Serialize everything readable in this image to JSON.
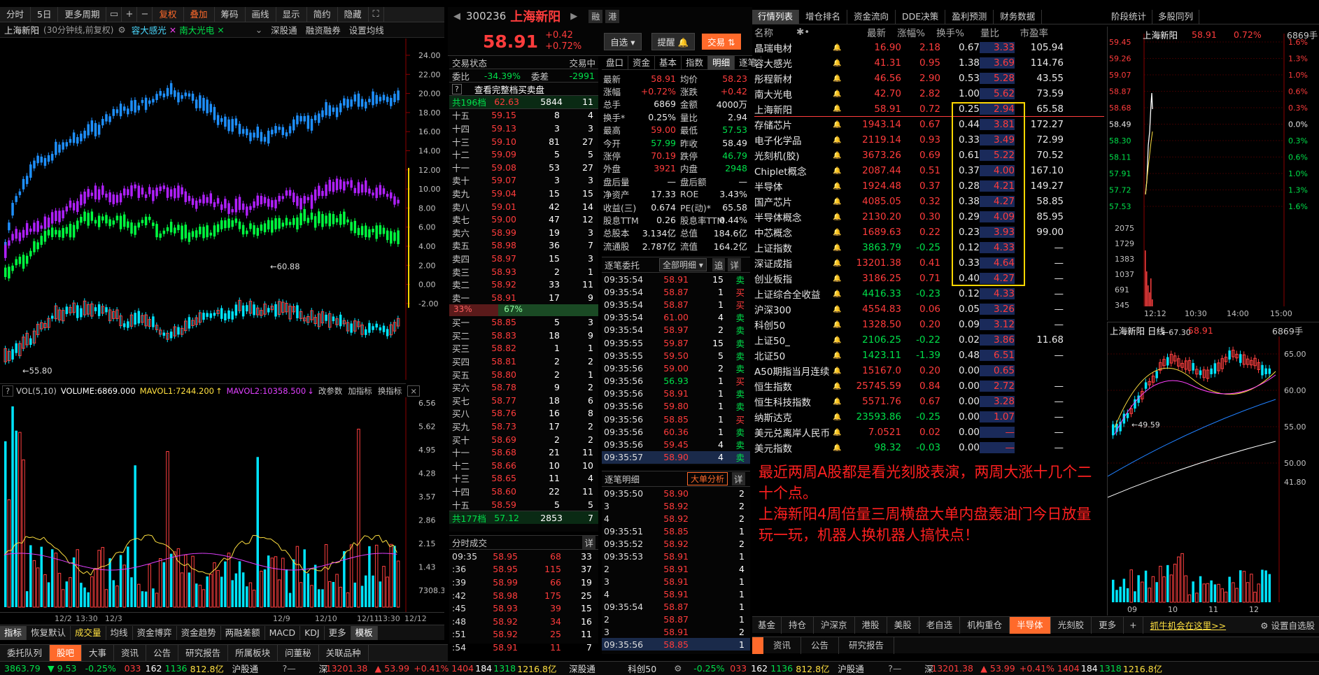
{
  "topbar": {
    "items": [
      "分时",
      "5日",
      "更多周期",
      "复权",
      "叠加",
      "筹码",
      "画线",
      "显示",
      "简约",
      "隐藏"
    ],
    "highlight": [
      "复权",
      "叠加"
    ]
  },
  "chart_header": {
    "stock": "上海新阳",
    "period_note": "(30分钟线,前复权)",
    "overlay1": "容大感光",
    "overlay2": "南大光电",
    "links": [
      "深股通",
      "融资融券",
      "设置均线"
    ]
  },
  "main_chart": {
    "y_right": [
      "24.00",
      "22.00",
      "20.00",
      "18.00",
      "16.00",
      "14.00",
      "12.00",
      "10.00",
      "8.00",
      "6.00",
      "4.00",
      "2.00",
      "0.00",
      "-2.00"
    ],
    "high_label": "60.88",
    "low_label": "55.80"
  },
  "vol_header": {
    "vol": "VOL(5,10)",
    "volume": "VOLUME:6869.000",
    "mavol1": "MAVOL1:7244.200",
    "mavol2": "MAVOL2:10358.500",
    "links": [
      "改参数",
      "加指标",
      "换指标"
    ]
  },
  "vol_axis": [
    "6.56",
    "5.62",
    "4.95",
    "4.28",
    "3.57",
    "2.86",
    "2.15",
    "1.43",
    "7308.33"
  ],
  "x_dates": [
    "12/2",
    "13:30",
    "12/3",
    "12/9",
    "12/10",
    "12/11",
    "13:30",
    "12/12"
  ],
  "chart_tabs": [
    "指标",
    "恢复默认",
    "成交量",
    "均线",
    "资金博弈",
    "资金趋势",
    "两融差额",
    "MACD",
    "KDJ",
    "更多",
    "模板"
  ],
  "bottom_tabs_left": [
    "委托队列",
    "股吧",
    "大事",
    "资讯",
    "公告",
    "研究报告",
    "所属板块",
    "问董秘",
    "关联品种"
  ],
  "quote": {
    "code": "300236",
    "name": "上海新阳",
    "price": "58.91",
    "change": "+0.42",
    "change_pct": "+0.72%",
    "btn_self": "自选",
    "btn_alert": "提醒",
    "btn_trade": "交易",
    "tags": [
      "融",
      "港"
    ]
  },
  "order_book": {
    "status_label": "交易状态",
    "status": "交易中",
    "weibi_label": "委比",
    "weibi": "-34.39%",
    "weicha_label": "委差",
    "weicha": "-2991",
    "view_full": "查看完整档买卖盘",
    "total_sell": {
      "label": "共196档",
      "price": "62.63",
      "vol": "5844",
      "n": "11"
    },
    "sells": [
      {
        "l": "十五",
        "p": "59.15",
        "v": "8",
        "n": "4"
      },
      {
        "l": "十四",
        "p": "59.13",
        "v": "3",
        "n": "3"
      },
      {
        "l": "十三",
        "p": "59.10",
        "v": "81",
        "n": "27"
      },
      {
        "l": "十二",
        "p": "59.09",
        "v": "5",
        "n": "5"
      },
      {
        "l": "十一",
        "p": "59.08",
        "v": "53",
        "n": "27"
      },
      {
        "l": "卖十",
        "p": "59.07",
        "v": "3",
        "n": "3"
      },
      {
        "l": "卖九",
        "p": "59.04",
        "v": "15",
        "n": "15"
      },
      {
        "l": "卖八",
        "p": "59.01",
        "v": "42",
        "n": "14"
      },
      {
        "l": "卖七",
        "p": "59.00",
        "v": "47",
        "n": "12"
      },
      {
        "l": "卖六",
        "p": "58.99",
        "v": "19",
        "n": "3"
      },
      {
        "l": "卖五",
        "p": "58.98",
        "v": "36",
        "n": "7"
      },
      {
        "l": "卖四",
        "p": "58.97",
        "v": "15",
        "n": "3"
      },
      {
        "l": "卖三",
        "p": "58.93",
        "v": "2",
        "n": "1"
      },
      {
        "l": "卖二",
        "p": "58.92",
        "v": "33",
        "n": "11"
      },
      {
        "l": "卖一",
        "p": "58.91",
        "v": "17",
        "n": "9"
      }
    ],
    "ratio_buy": "33%",
    "ratio_sell": "67%",
    "buys": [
      {
        "l": "买一",
        "p": "58.85",
        "v": "5",
        "n": "3"
      },
      {
        "l": "买二",
        "p": "58.83",
        "v": "18",
        "n": "9"
      },
      {
        "l": "买三",
        "p": "58.82",
        "v": "1",
        "n": "1"
      },
      {
        "l": "买四",
        "p": "58.81",
        "v": "2",
        "n": "2"
      },
      {
        "l": "买五",
        "p": "58.80",
        "v": "2",
        "n": "1"
      },
      {
        "l": "买六",
        "p": "58.78",
        "v": "9",
        "n": "2"
      },
      {
        "l": "买七",
        "p": "58.77",
        "v": "18",
        "n": "6"
      },
      {
        "l": "买八",
        "p": "58.76",
        "v": "16",
        "n": "8"
      },
      {
        "l": "买九",
        "p": "58.73",
        "v": "17",
        "n": "2"
      },
      {
        "l": "买十",
        "p": "58.69",
        "v": "2",
        "n": "2"
      },
      {
        "l": "十一",
        "p": "58.68",
        "v": "21",
        "n": "11"
      },
      {
        "l": "十二",
        "p": "58.66",
        "v": "10",
        "n": "10"
      },
      {
        "l": "十三",
        "p": "58.65",
        "v": "11",
        "n": "4"
      },
      {
        "l": "十四",
        "p": "58.60",
        "v": "22",
        "n": "11"
      },
      {
        "l": "十五",
        "p": "58.59",
        "v": "5",
        "n": "5"
      }
    ],
    "total_buy": {
      "label": "共177档",
      "price": "57.12",
      "vol": "2853",
      "n": "7"
    }
  },
  "minute_trades": {
    "title": "分时成交",
    "detail": "详",
    "rows": [
      {
        "t": "09:35",
        "p": "58.95",
        "v": "68",
        "n": "33"
      },
      {
        "t": ":36",
        "p": "58.95",
        "v": "115",
        "n": "37"
      },
      {
        "t": ":39",
        "p": "58.99",
        "v": "66",
        "n": "19"
      },
      {
        "t": ":42",
        "p": "58.98",
        "v": "175",
        "n": "25"
      },
      {
        "t": ":45",
        "p": "58.93",
        "v": "39",
        "n": "15"
      },
      {
        "t": ":48",
        "p": "58.92",
        "v": "34",
        "n": "16"
      },
      {
        "t": ":51",
        "p": "58.92",
        "v": "25",
        "n": "11"
      },
      {
        "t": ":54",
        "p": "58.91",
        "v": "11",
        "n": "7"
      }
    ]
  },
  "detail_tabs": [
    "盘口",
    "资金",
    "基本",
    "指数",
    "明细",
    "逐笔"
  ],
  "stats": [
    [
      "最新",
      "58.91",
      "均价",
      "58.23"
    ],
    [
      "涨幅",
      "+0.72%",
      "涨跌",
      "+0.42"
    ],
    [
      "总手",
      "6869",
      "金额",
      "4000万"
    ],
    [
      "换手*",
      "0.25%",
      "量比",
      "2.94"
    ],
    [
      "最高",
      "59.00",
      "最低",
      "57.53"
    ],
    [
      "今开",
      "57.99",
      "昨收",
      "58.49"
    ],
    [
      "涨停",
      "70.19",
      "跌停",
      "46.79"
    ],
    [
      "外盘",
      "3921",
      "内盘",
      "2948"
    ],
    [
      "盘后量",
      "—",
      "盘后额",
      "—"
    ],
    [
      "净资产",
      "17.33",
      "ROE",
      "3.43%"
    ],
    [
      "收益(三)",
      "0.674",
      "PE(动)*",
      "65.58"
    ],
    [
      "股息TTM",
      "0.26",
      "股息率TTM",
      "0.44%"
    ],
    [
      "总股本",
      "3.134亿",
      "总值",
      "184.6亿"
    ],
    [
      "流通股",
      "2.787亿",
      "流值",
      "164.2亿"
    ]
  ],
  "tick_entrust": {
    "title": "逐笔委托",
    "filter": "全部明细",
    "btns": [
      "追",
      "详"
    ],
    "rows": [
      [
        "09:35:54",
        "58.91",
        "15",
        "卖"
      ],
      [
        "09:35:54",
        "58.87",
        "1",
        "买"
      ],
      [
        "09:35:54",
        "58.87",
        "1",
        "买"
      ],
      [
        "09:35:54",
        "61.00",
        "4",
        "卖"
      ],
      [
        "09:35:54",
        "58.97",
        "2",
        "卖"
      ],
      [
        "09:35:55",
        "59.87",
        "15",
        "卖"
      ],
      [
        "09:35:55",
        "59.50",
        "5",
        "卖"
      ],
      [
        "09:35:56",
        "59.00",
        "2",
        "卖"
      ],
      [
        "09:35:56",
        "56.93",
        "1",
        "买"
      ],
      [
        "09:35:56",
        "58.91",
        "1",
        "卖"
      ],
      [
        "09:35:56",
        "59.80",
        "1",
        "卖"
      ],
      [
        "09:35:56",
        "58.85",
        "1",
        "买"
      ],
      [
        "09:35:56",
        "60.36",
        "1",
        "卖"
      ],
      [
        "09:35:56",
        "59.45",
        "4",
        "卖"
      ],
      [
        "09:35:57",
        "58.90",
        "4",
        "卖"
      ]
    ]
  },
  "tick_detail": {
    "title": "逐笔明细",
    "big": "大单分析",
    "detail": "详",
    "rows": [
      [
        "09:35:50",
        "58.90",
        "2"
      ],
      [
        "3",
        "58.92",
        "2"
      ],
      [
        "4",
        "58.92",
        "2"
      ],
      [
        "09:35:51",
        "58.85",
        "1"
      ],
      [
        "09:35:52",
        "58.92",
        "2"
      ],
      [
        "09:35:53",
        "58.91",
        "1"
      ],
      [
        "2",
        "58.91",
        "4"
      ],
      [
        "3",
        "58.91",
        "1"
      ],
      [
        "4",
        "58.91",
        "1"
      ],
      [
        "09:35:54",
        "58.87",
        "1"
      ],
      [
        "2",
        "58.87",
        "1"
      ],
      [
        "3",
        "58.91",
        "2"
      ],
      [
        "09:35:56",
        "58.85",
        "1"
      ]
    ]
  },
  "list_tabs": [
    "行情列表",
    "增仓排名",
    "资金流向",
    "DDE决策",
    "盈利预测",
    "财务数据",
    "阶段统计",
    "多股同列"
  ],
  "list_headers": [
    "名称",
    "最新",
    "涨幅%",
    "换手%",
    "量比",
    "市盈率"
  ],
  "list_rows": [
    {
      "name": "晶瑞电材",
      "r": true,
      "last": "16.90",
      "pct": "2.18",
      "turn": "0.67",
      "vr": "3.33",
      "pe": "105.94",
      "c": "r"
    },
    {
      "name": "容大感光",
      "r": true,
      "last": "41.31",
      "pct": "0.95",
      "turn": "1.38",
      "vr": "3.69",
      "pe": "114.76",
      "c": "r"
    },
    {
      "name": "彤程新材",
      "r": true,
      "last": "46.56",
      "pct": "2.90",
      "turn": "0.53",
      "vr": "5.28",
      "pe": "43.55",
      "c": "r"
    },
    {
      "name": "南大光电",
      "r": true,
      "last": "42.70",
      "pct": "2.82",
      "turn": "1.00",
      "vr": "5.62",
      "pe": "73.59",
      "c": "r"
    },
    {
      "name": "上海新阳",
      "r": true,
      "last": "58.91",
      "pct": "0.72",
      "turn": "0.25",
      "vr": "2.94",
      "pe": "65.58",
      "c": "r"
    },
    {
      "name": "存储芯片",
      "last": "1943.14",
      "pct": "0.67",
      "turn": "0.44",
      "vr": "3.81",
      "pe": "172.27",
      "c": "r"
    },
    {
      "name": "电子化学品",
      "last": "2119.14",
      "pct": "0.93",
      "turn": "0.33",
      "vr": "3.49",
      "pe": "72.99",
      "c": "r"
    },
    {
      "name": "光刻机(胶)",
      "last": "3673.26",
      "pct": "0.69",
      "turn": "0.61",
      "vr": "5.22",
      "pe": "70.52",
      "c": "r"
    },
    {
      "name": "Chiplet概念",
      "last": "2087.44",
      "pct": "0.51",
      "turn": "0.37",
      "vr": "4.00",
      "pe": "167.10",
      "c": "r"
    },
    {
      "name": "半导体",
      "last": "1924.48",
      "pct": "0.37",
      "turn": "0.28",
      "vr": "4.21",
      "pe": "149.27",
      "c": "r"
    },
    {
      "name": "国产芯片",
      "last": "4085.05",
      "pct": "0.32",
      "turn": "0.38",
      "vr": "4.27",
      "pe": "58.85",
      "c": "r"
    },
    {
      "name": "半导体概念",
      "last": "2130.20",
      "pct": "0.30",
      "turn": "0.29",
      "vr": "4.09",
      "pe": "85.95",
      "c": "r"
    },
    {
      "name": "中芯概念",
      "last": "1689.63",
      "pct": "0.22",
      "turn": "0.23",
      "vr": "3.93",
      "pe": "99.00",
      "c": "r"
    },
    {
      "name": "上证指数",
      "last": "3863.79",
      "pct": "-0.25",
      "turn": "0.12",
      "vr": "4.33",
      "pe": "—",
      "c": "g"
    },
    {
      "name": "深证成指",
      "last": "13201.38",
      "pct": "0.41",
      "turn": "0.33",
      "vr": "4.64",
      "pe": "—",
      "c": "r"
    },
    {
      "name": "创业板指",
      "last": "3186.25",
      "pct": "0.71",
      "turn": "0.40",
      "vr": "4.27",
      "pe": "—",
      "c": "r"
    },
    {
      "name": "上证综合全收益",
      "last": "4416.33",
      "pct": "-0.23",
      "turn": "0.12",
      "vr": "4.33",
      "pe": "—",
      "c": "g"
    },
    {
      "name": "沪深300",
      "last": "4554.83",
      "pct": "0.06",
      "turn": "0.05",
      "vr": "3.26",
      "pe": "—",
      "c": "r"
    },
    {
      "name": "科创50",
      "last": "1328.50",
      "pct": "0.20",
      "turn": "0.09",
      "vr": "3.12",
      "pe": "—",
      "c": "r"
    },
    {
      "name": "上证50_",
      "last": "2106.25",
      "pct": "-0.22",
      "turn": "0.02",
      "vr": "3.86",
      "pe": "11.68",
      "c": "g"
    },
    {
      "name": "北证50",
      "last": "1423.11",
      "pct": "-1.39",
      "turn": "0.48",
      "vr": "6.51",
      "pe": "—",
      "c": "g"
    },
    {
      "name": "A50期指当月连续",
      "last": "15167.0",
      "pct": "0.20",
      "turn": "0.00",
      "vr": "0.65",
      "pe": "",
      "c": "r"
    },
    {
      "name": "恒生指数",
      "last": "25745.59",
      "pct": "0.84",
      "turn": "0.00",
      "vr": "2.72",
      "pe": "—",
      "c": "r"
    },
    {
      "name": "恒生科技指数",
      "last": "5571.76",
      "pct": "0.67",
      "turn": "0.00",
      "vr": "3.28",
      "pe": "—",
      "c": "r"
    },
    {
      "name": "纳斯达克",
      "last": "23593.86",
      "pct": "-0.25",
      "turn": "0.00",
      "vr": "1.07",
      "pe": "—",
      "c": "g"
    },
    {
      "name": "美元兑离岸人民币",
      "last": "7.0521",
      "pct": "0.02",
      "turn": "0.00",
      "vr": "—",
      "pe": "—",
      "c": "r"
    },
    {
      "name": "美元指数",
      "last": "98.32",
      "pct": "-0.03",
      "turn": "0.00",
      "vr": "—",
      "pe": "—",
      "c": "g"
    }
  ],
  "note": {
    "line1": "最近两周A股都是看光刻胶表演，两周大涨十几个二十个点。",
    "line2": "上海新阳4周倍量三周横盘大单内盘轰油门今日放量玩一玩，机器人换机器人搞快点！"
  },
  "mini_intraday": {
    "name": "上海新阳",
    "price": "58.91",
    "pct": "0.72%",
    "vol": "6869手",
    "y_left": [
      "59.45",
      "59.26",
      "59.07",
      "58.87",
      "58.68",
      "58.49",
      "58.30",
      "58.11",
      "57.91",
      "57.72",
      "57.53"
    ],
    "y_right": [
      "1.6%",
      "1.3%",
      "1.0%",
      "0.6%",
      "0.3%",
      "0.0%",
      "0.3%",
      "0.6%",
      "1.0%",
      "1.3%",
      "1.6%"
    ],
    "vol_axis": [
      "2075",
      "1729",
      "1383",
      "1037",
      "691",
      "345"
    ],
    "x": [
      "12:12",
      "10:30",
      "14:00",
      "15:00"
    ]
  },
  "mini_daily": {
    "title": "上海新阳 日线",
    "price": "58.91",
    "vol": "6869手",
    "high": "67.30",
    "low": "49.59",
    "y": [
      "65.00",
      "60.00",
      "55.00",
      "50.00"
    ],
    "vol_top": "41.80",
    "x": [
      "09",
      "10",
      "11",
      "12"
    ]
  },
  "sector_tabs": [
    "基金",
    "持仓",
    "沪深京",
    "港股",
    "美股",
    "老自选",
    "机构重仓",
    "半导体",
    "光刻胶",
    "更多"
  ],
  "sector_link": "抓牛机会在这里>>",
  "sector_setting": "设置自选股",
  "sub_tabs": [
    "资讯",
    "公告",
    "研究报告"
  ],
  "status_bar": {
    "sh": "3863.79",
    "sh_chg": "9.53",
    "sh_pct": "-0.25%",
    "sh_up": "033",
    "sh_eq": "162",
    "sh_dn": "1136",
    "sh_amt": "812.8亿",
    "hgt": "沪股通",
    "sz_label": "深",
    "sz": "13201.38",
    "sz_chg": "53.99",
    "sz_pct": "+0.41%",
    "sz_up": "1404",
    "sz_eq": "184",
    "sz_dn": "1318",
    "sz_amt": "1216.8亿",
    "sgt": "深股通",
    "kc": "科创50"
  },
  "colors": {
    "up": "#ff3c3c",
    "down": "#00e04a",
    "accent": "#ff6a2b",
    "bg": "#000000"
  }
}
